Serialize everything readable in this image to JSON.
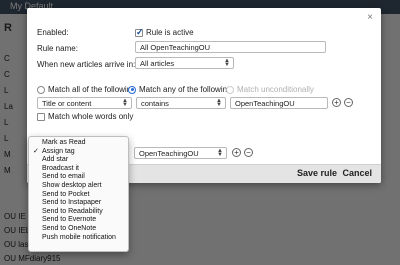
{
  "background": {
    "topbar_label": "My Default",
    "heading": "R",
    "rows": [
      "C",
      "C",
      "L",
      "La",
      "L",
      "L",
      "M",
      "M",
      "OU IE",
      "OU IEL",
      "OU las",
      "OU MFdiary915"
    ]
  },
  "dialog": {
    "close_label": "×",
    "enabled_label": "Enabled:",
    "rule_active_label": "Rule is active",
    "rule_active_checked": true,
    "rule_name_label": "Rule name:",
    "rule_name_value": "All OpenTeachingOU",
    "when_new_label": "When new articles arrive in:",
    "feed_select_value": "All articles",
    "match_all_label": "Match all of the following",
    "match_any_label": "Match any of the following",
    "match_uncond_label": "Match unconditionally",
    "selected_match": "any",
    "condition": {
      "field_value": "Title or content",
      "operator_value": "contains",
      "text_value": "OpenTeachingOU"
    },
    "match_whole_words_label": "Match whole words only",
    "match_whole_words_checked": false,
    "action": {
      "tag_value": "OpenTeachingOU"
    },
    "save_label": "Save rule",
    "cancel_label": "Cancel"
  },
  "action_menu": {
    "items": [
      {
        "label": "Mark as Read",
        "checked": false
      },
      {
        "label": "Assign tag",
        "checked": true
      },
      {
        "label": "Add star",
        "checked": false
      },
      {
        "label": "Broadcast it",
        "checked": false
      },
      {
        "label": "Send to email",
        "checked": false
      },
      {
        "label": "Show desktop alert",
        "checked": false
      },
      {
        "label": "Send to Pocket",
        "checked": false
      },
      {
        "label": "Send to Instapaper",
        "checked": false
      },
      {
        "label": "Send to Readability",
        "checked": false
      },
      {
        "label": "Send to Evernote",
        "checked": false
      },
      {
        "label": "Send to OneNote",
        "checked": false
      },
      {
        "label": "Push mobile notification",
        "checked": false
      }
    ]
  },
  "colors": {
    "accent": "#2a6ad3",
    "footer_bg": "#e4e4e4",
    "overlay": "#6b6b6b"
  }
}
